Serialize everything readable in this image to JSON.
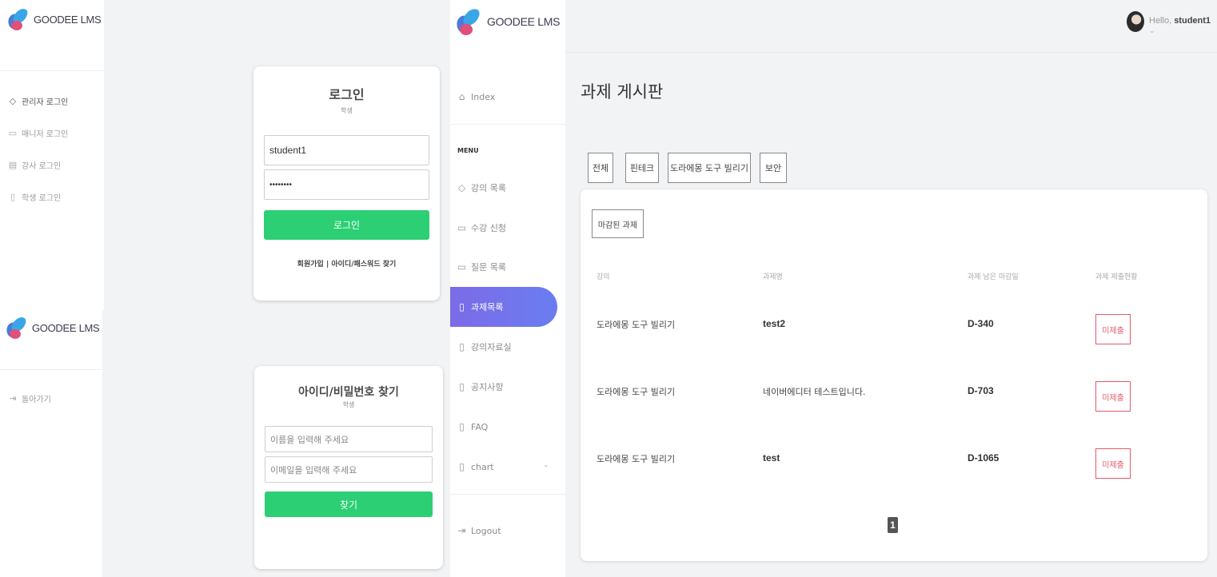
{
  "brand": {
    "name": "GOODEE LMS"
  },
  "login_panel": {
    "sidebar_links": [
      {
        "label": "관리자 로그인",
        "icon": "tag-icon"
      },
      {
        "label": "매니저 로그인",
        "icon": "chat-icon"
      },
      {
        "label": "강사 로그인",
        "icon": "calendar-icon"
      },
      {
        "label": "학생 로그인",
        "icon": "document-icon"
      }
    ],
    "card": {
      "title": "로그인",
      "subtitle": "학생",
      "id_value": "student1",
      "password_value": "••••••••",
      "submit_label": "로그인",
      "signup_link": "회원가입",
      "separator": "|",
      "find_link": "아이디/패스워드 찾기"
    }
  },
  "find_panel": {
    "back_label": "돌아가기",
    "card": {
      "title": "아이디/비밀번호 찾기",
      "subtitle": "학생",
      "name_placeholder": "이름을 입력해 주세요",
      "email_placeholder": "이메일을 입력해 주세요",
      "submit_label": "찾기"
    }
  },
  "assignment_panel": {
    "nav": {
      "index": "Index",
      "menu_header": "MENU",
      "items": [
        {
          "label": "강의 목록",
          "icon": "tag-icon"
        },
        {
          "label": "수강 신청",
          "icon": "chat-icon"
        },
        {
          "label": "질문 목록",
          "icon": "chat-icon"
        },
        {
          "label": "과제목록",
          "icon": "document-icon",
          "active": true
        },
        {
          "label": "강의자료실",
          "icon": "document-icon"
        },
        {
          "label": "공지사항",
          "icon": "document-icon"
        },
        {
          "label": "FAQ",
          "icon": "document-icon"
        },
        {
          "label": "chart",
          "icon": "document-icon"
        }
      ],
      "logout": "Logout"
    },
    "header": {
      "greeting": "Hello,",
      "username": "student1"
    },
    "page_title": "과제 게시판",
    "filters": [
      "전체",
      "핀테크",
      "도라에몽 도구 빌리기",
      "보안"
    ],
    "expired_button": "마감된 과제",
    "columns": [
      "강의",
      "과제명",
      "과제 남은 마감일",
      "과제 제출현황"
    ],
    "rows": [
      {
        "course": "도라에몽 도구 빌리기",
        "title": "test2",
        "deadline": "D-340",
        "status": "미제출"
      },
      {
        "course": "도라에몽 도구 빌리기",
        "title": "네이버에디터 테스트입니다.",
        "deadline": "D-703",
        "status": "미제출"
      },
      {
        "course": "도라에몽 도구 빌리기",
        "title": "test",
        "deadline": "D-1065",
        "status": "미제출"
      }
    ],
    "pagination": {
      "current": "1"
    }
  },
  "colors": {
    "green": "#2ccf73",
    "accent": "#6f74ec",
    "danger": "#e45a6a"
  }
}
